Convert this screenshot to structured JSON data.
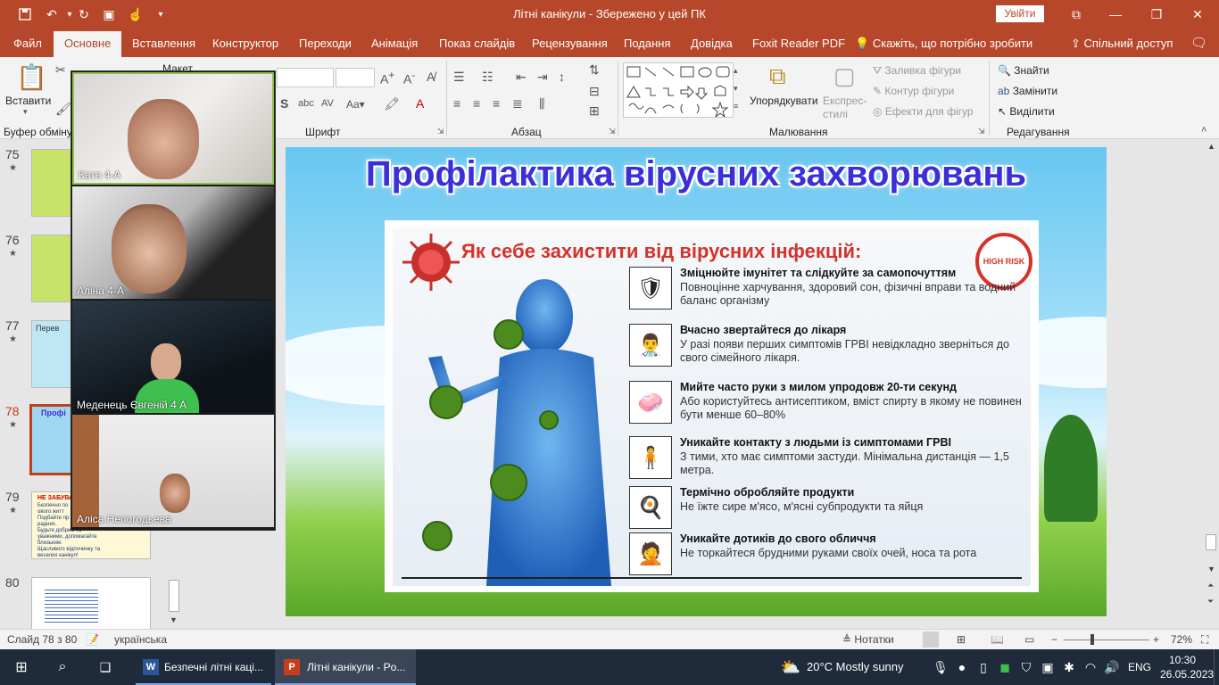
{
  "title_bar": {
    "document_title": "Літні канікули  -  Збережено у цей ПК",
    "signin_label": "Увійти"
  },
  "tabs": [
    "Файл",
    "Основне",
    "Вставлення",
    "Конструктор",
    "Переходи",
    "Анімація",
    "Показ слайдів",
    "Рецензування",
    "Подання",
    "Довідка",
    "Foxit Reader PDF",
    "Скажіть, що потрібно зробити",
    "Спільний доступ"
  ],
  "ribbon": {
    "paste": "Вставити",
    "clipboard": "Буфер обміну",
    "create_hidden": "Макет",
    "font_group": "Шрифт",
    "paragraph_group": "Абзац",
    "arrange": "Упорядкувати",
    "quick_styles": "Експрес-стилі",
    "fill": "Заливка фігури",
    "outline": "Контур фігури",
    "effects": "Ефекти для фігур",
    "drawing_group": "Малювання",
    "find": "Знайти",
    "replace": "Замінити",
    "select": "Виділити",
    "editing_group": "Редагування",
    "font_size_value": ""
  },
  "thumbs": [
    {
      "num": "75",
      "star": "★"
    },
    {
      "num": "76",
      "star": "★"
    },
    {
      "num": "77",
      "star": "★",
      "text": "Перев"
    },
    {
      "num": "78",
      "star": "★",
      "text": "Профі"
    },
    {
      "num": "79",
      "star": "★",
      "text": "НЕ ЗАБУВА",
      "lines": [
        "Безпечно по",
        "ового житт",
        "Подбайте пр",
        "радних.",
        "Будьте добрим та",
        "уважними, допомагайте",
        "близьким.",
        "Щасливого відпочинку та",
        "веселих канікул!"
      ]
    },
    {
      "num": "80"
    }
  ],
  "participants": [
    {
      "name": "Катя  4-А"
    },
    {
      "name": "Аліна 4-А"
    },
    {
      "name": "Меденець Євгеній 4 А"
    },
    {
      "name": "Аліса Непогодьева"
    }
  ],
  "slide": {
    "title": "Профілактика вірусних захворювань",
    "poster_heading": "Як себе захистити від вірусних інфекцій:",
    "badge": "HIGH RISK",
    "rows": [
      {
        "title": "Зміцнюйте імунітет та слідкуйте за самопочуттям",
        "desc": "Повноцінне харчування, здоровий сон, фізичні вправи та водний баланс організму"
      },
      {
        "title": "Вчасно звертайтеся до лікаря",
        "desc": "У разі появи перших симптомів ГРВІ невідкладно зверніться до свого сімейного лікаря."
      },
      {
        "title": "Мийте часто руки з милом упродовж 20-ти секунд",
        "desc": "Або користуйтесь антисептиком, вміст спирту в якому не повинен бути менше 60–80%"
      },
      {
        "title": "Уникайте контакту з людьми із симптомами ГРВІ",
        "desc": "З тими, хто має симптоми застуди. Мінімальна дистанція — 1,5 метра."
      },
      {
        "title": "Термічно обробляйте продукти",
        "desc": "Не їжте сире м'ясо, м'ясні субпродукти та яйця"
      },
      {
        "title": "Уникайте дотиків до свого обличчя",
        "desc": "Не торкайтеся брудними руками своїх очей, носа та рота"
      }
    ]
  },
  "status": {
    "slide_counter": "Слайд 78 з 80",
    "language": "українська",
    "notes": "Нотатки",
    "zoom": "72%"
  },
  "taskbar": {
    "app1": "Безпечні літні каці...",
    "app2": "Літні канікули - Po...",
    "weather": "20°C  Mostly sunny",
    "lang": "ENG",
    "time": "10:30",
    "date": "26.05.2023"
  }
}
